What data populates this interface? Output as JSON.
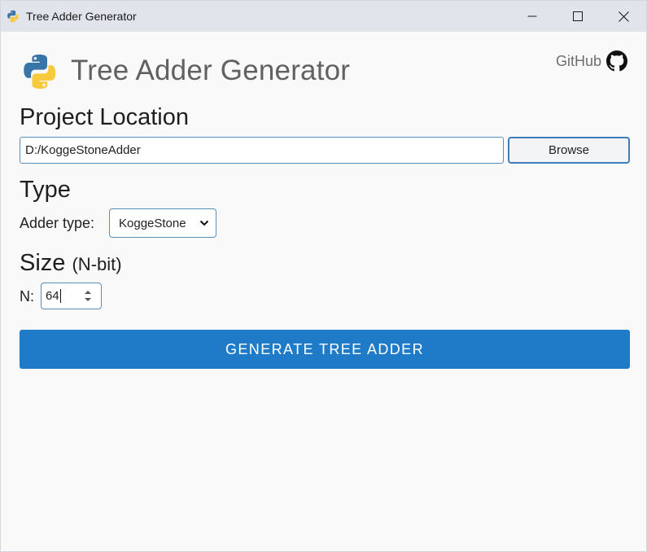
{
  "window": {
    "title": "Tree Adder Generator",
    "icon": "python-logo-icon",
    "controls": [
      "minimize",
      "maximize",
      "close"
    ]
  },
  "header": {
    "title": "Tree Adder Generator",
    "logo": "python-logo-icon",
    "github_label": "GitHub",
    "github_icon": "github-icon"
  },
  "project_location": {
    "heading": "Project Location",
    "path_value": "D:/KoggeStoneAdder",
    "browse_label": "Browse"
  },
  "type": {
    "heading": "Type",
    "adder_label": "Adder type:",
    "adder_selected": "KoggeStone"
  },
  "size": {
    "heading": "Size",
    "heading_sub": "(N-bit)",
    "n_label": "N:",
    "n_value": "64"
  },
  "generate": {
    "label": "GENERATE TREE ADDER"
  },
  "colors": {
    "accent": "#1f7bc8",
    "titlebar": "#e1e4ea",
    "background": "#f9f9fa",
    "heading_gray": "#616161",
    "python_blue": "#3774a8",
    "python_yellow": "#f7c93b"
  }
}
